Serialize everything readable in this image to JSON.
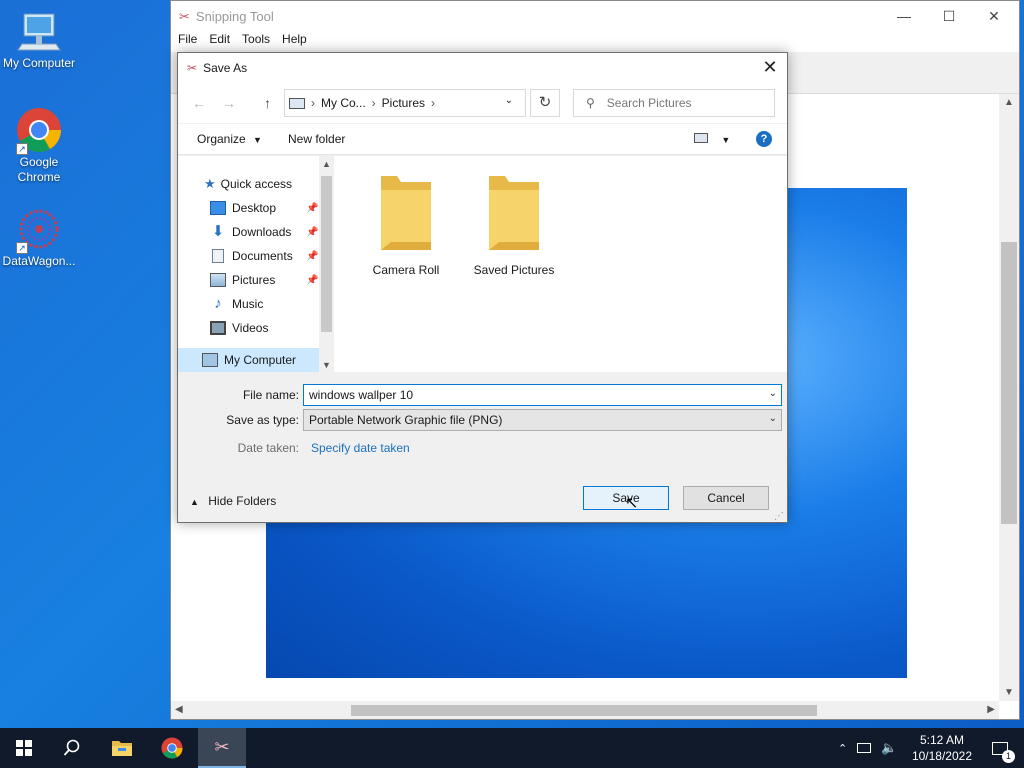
{
  "desktop": {
    "icons": [
      {
        "label": "My Computer"
      },
      {
        "label": "Google Chrome"
      },
      {
        "label": "DataWagon..."
      }
    ]
  },
  "snipping_tool": {
    "title": "Snipping Tool",
    "menu": [
      "File",
      "Edit",
      "Tools",
      "Help"
    ],
    "controls": {
      "minimize": "—",
      "maximize": "☐",
      "close": "✕"
    }
  },
  "save_dialog": {
    "title": "Save As",
    "breadcrumb": [
      "My Co...",
      "Pictures"
    ],
    "search_placeholder": "Search Pictures",
    "organize_label": "Organize",
    "new_folder_label": "New folder",
    "help_label": "?",
    "nav": {
      "quick_access": "Quick access",
      "items": [
        {
          "label": "Desktop",
          "pinned": true,
          "icon": "desktop-icon"
        },
        {
          "label": "Downloads",
          "pinned": true,
          "icon": "download-arrow-icon"
        },
        {
          "label": "Documents",
          "pinned": true,
          "icon": "document-icon"
        },
        {
          "label": "Pictures",
          "pinned": true,
          "icon": "pictures-icon"
        },
        {
          "label": "Music",
          "pinned": false,
          "icon": "music-note-icon"
        },
        {
          "label": "Videos",
          "pinned": false,
          "icon": "film-icon"
        }
      ],
      "my_computer": "My Computer"
    },
    "folders": [
      "Camera Roll",
      "Saved Pictures"
    ],
    "file_name_label": "File name:",
    "file_name_value": "windows wallper 10",
    "save_as_type_label": "Save as type:",
    "save_as_type_value": "Portable Network Graphic file (PNG)",
    "date_taken_label": "Date taken:",
    "date_taken_link": "Specify date taken",
    "hide_folders_label": "Hide Folders",
    "save_button": "Save",
    "cancel_button": "Cancel"
  },
  "taskbar": {
    "time": "5:12 AM",
    "date": "10/18/2022",
    "notification_count": "1"
  },
  "colors": {
    "accent": "#0078d7",
    "link": "#1a6fc2",
    "folder": "#f2ca5b",
    "taskbar": "#101a2a"
  }
}
